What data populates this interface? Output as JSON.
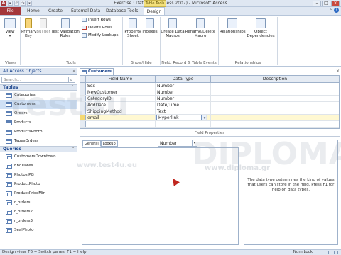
{
  "window": {
    "title": "Exercise : Database (Access 2007)  -  Microsoft Access",
    "context_tab_label": "Table Tools",
    "app_icon_letter": "A"
  },
  "ribbon_tabs": [
    {
      "label": "File",
      "active": false
    },
    {
      "label": "Home",
      "active": false
    },
    {
      "label": "Create",
      "active": false
    },
    {
      "label": "External Data",
      "active": false
    },
    {
      "label": "Database Tools",
      "active": false
    },
    {
      "label": "Design",
      "active": true
    }
  ],
  "ribbon": {
    "view": "View",
    "primary_key": "Primary Key",
    "builder": "Builder",
    "test_validation": "Test Validation Rules",
    "insert_rows": "Insert Rows",
    "delete_rows": "Delete Rows",
    "modify_lookups": "Modify Lookups",
    "property_sheet": "Property Sheet",
    "indexes": "Indexes",
    "create_data_macros": "Create Data Macros",
    "rename_delete_macro": "Rename/Delete Macro",
    "relationships": "Relationships",
    "object_dependencies": "Object Dependencies",
    "groups": {
      "views": "Views",
      "tools": "Tools",
      "show_hide": "Show/Hide",
      "field_record_table_events": "Field, Record & Table Events",
      "relationships": "Relationships"
    }
  },
  "nav": {
    "header": "All Access Objects",
    "search_placeholder": "Search...",
    "groups": [
      {
        "label": "Tables",
        "items": [
          "Categories",
          "Customers",
          "Orders",
          "Products",
          "ProductsPhoto",
          "TypesOrders"
        ],
        "selected": "Customers"
      },
      {
        "label": "Queries",
        "items": [
          "CustomersDowntown",
          "EndDates",
          "PhotosJPG",
          "ProductPhoto",
          "ProductPriceMin",
          "r_orders",
          "r_orders2",
          "r_orders3",
          "SealPhoto"
        ]
      }
    ]
  },
  "document_tab": {
    "label": "Customers"
  },
  "design_grid": {
    "columns": [
      "Field Name",
      "Data Type",
      "Description"
    ],
    "rows": [
      {
        "field": "Sex",
        "type": "Number"
      },
      {
        "field": "NewCustomer",
        "type": "Number"
      },
      {
        "field": "CategoryID",
        "type": "Number"
      },
      {
        "field": "AddDate",
        "type": "Date/Time"
      },
      {
        "field": "ShippingMethod",
        "type": "Text"
      },
      {
        "field": "email",
        "type": "Hyperlink"
      }
    ]
  },
  "field_properties": {
    "title": "Field Properties",
    "tabs": [
      "General",
      "Lookup"
    ],
    "active_tab": "General",
    "type_value": "Number",
    "help_text": "The data type determines the kind of values that users can store in the field. Press F1 for help on data types."
  },
  "status_bar": {
    "left_text": "Design view.  F6 = Switch panes.  F1 = Help.",
    "num_lock": "Num Lock"
  },
  "watermarks": {
    "test4u": "test4u",
    "diploma": "DIPLOMA",
    "url1": "www.test4u.eu",
    "url2": "www.diploma.gr"
  },
  "colors": {
    "file_tab": "#a4373a",
    "ribbon_bg": "#dfe7f2",
    "selection": "#cfe0f5",
    "current_row": "#fff8d2"
  }
}
